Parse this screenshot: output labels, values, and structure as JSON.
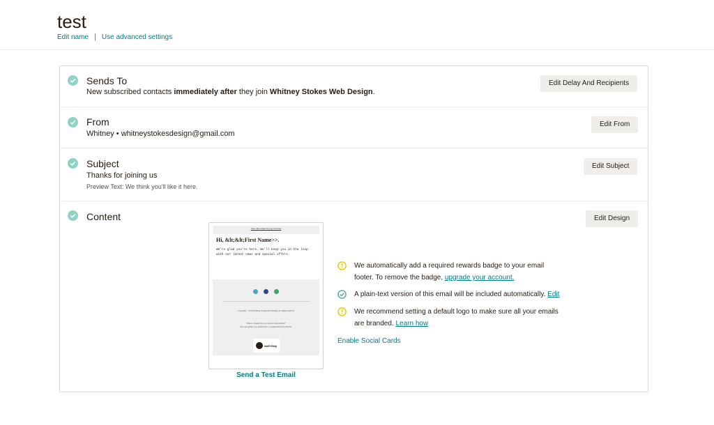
{
  "header": {
    "title": "test",
    "edit_name": "Edit name",
    "separator": "|",
    "advanced": "Use advanced settings"
  },
  "sections": {
    "sends_to": {
      "title": "Sends To",
      "desc_1": "New subscribed contacts ",
      "desc_bold_1": "immediately after",
      "desc_2": " they join ",
      "desc_bold_2": "Whitney Stokes Web Design",
      "desc_3": ".",
      "button": "Edit Delay And Recipients"
    },
    "from": {
      "title": "From",
      "desc": "Whitney • whitneystokesdesign@gmail.com",
      "button": "Edit From"
    },
    "subject": {
      "title": "Subject",
      "desc": "Thanks for joining us",
      "preview": "Preview Text: We think you'll like it here.",
      "button": "Edit Subject"
    },
    "content": {
      "title": "Content",
      "button": "Edit Design",
      "send_test": "Send a Test Email",
      "thumbnail": {
        "top_link": "View this email in your browser",
        "greeting": "Hi, &lt;&lt;First Name>>.",
        "body": "We're glad you're here. We'll keep you in the loop with our latest news and special offers.",
        "copyright": "Copyright © 2018 Whitney Stokes Web Design, All rights reserved.",
        "want_change": "Want to change how you receive these emails?",
        "update_prefs": "You can update your preferences or unsubscribe from this list.",
        "badge_text": "mailchimp"
      },
      "notices": [
        {
          "icon": "warning-icon",
          "text": "We automatically add a required rewards badge to your email footer. To remove the badge, ",
          "link": "upgrade your account."
        },
        {
          "icon": "check-circle-icon",
          "text": "A plain-text version of this email will be included automatically. ",
          "link": "Edit"
        },
        {
          "icon": "warning-icon",
          "text": "We recommend setting a default logo to make sure all your emails are branded. ",
          "link": "Learn how"
        }
      ],
      "enable_social": "Enable Social Cards"
    }
  },
  "colors": {
    "check": "#8fd3c7",
    "link": "#007c89",
    "warning": "#f2c200",
    "success": "#4ca89a",
    "button_bg": "#efeeea",
    "social_1": "#4aa7c7",
    "social_2": "#2b4a8a",
    "social_3": "#38a36a"
  }
}
